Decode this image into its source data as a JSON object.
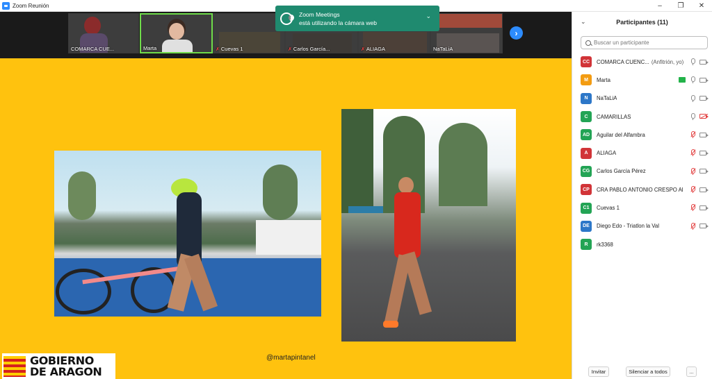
{
  "window": {
    "title": "Zoom Reunión"
  },
  "toast": {
    "line1": "Zoom Meetings",
    "line2": "está utilizando la cámara web"
  },
  "video_strip": [
    {
      "label": "COMARCA CUE...",
      "muted": false,
      "bg": "#cfc6bf"
    },
    {
      "label": "Marta",
      "muted": false,
      "bg": "#d8d4cf"
    },
    {
      "label": "Cuevas 1",
      "muted": true,
      "bg": "#6c6a64"
    },
    {
      "label": "Carlos García...",
      "muted": true,
      "bg": "#5c5a58"
    },
    {
      "label": "ALIAGA",
      "muted": true,
      "bg": "#6a5f57"
    },
    {
      "label": "NaTaLiA",
      "muted": false,
      "bg": "#7e7a78"
    }
  ],
  "shared": {
    "handle": "@martapintanel",
    "logo_line1": "GOBIERNO",
    "logo_line2": "DE ARAGON",
    "bg": "#ffc20e"
  },
  "panel": {
    "title": "Participantes (11)",
    "search_placeholder": "Buscar un participante",
    "participants": [
      {
        "initials": "CC",
        "name": "COMARCA CUENC...",
        "role": "(Anfitrión, yo)",
        "color": "#d13438",
        "mic": "on",
        "cam": "on",
        "sharing": false
      },
      {
        "initials": "M",
        "name": "Marta",
        "role": "",
        "color": "#f39c12",
        "mic": "on",
        "cam": "on",
        "sharing": true
      },
      {
        "initials": "N",
        "name": "NaTaLiA",
        "role": "",
        "color": "#2d77c8",
        "mic": "on",
        "cam": "on",
        "sharing": false
      },
      {
        "initials": "C",
        "name": "CAMARILLAS",
        "role": "",
        "color": "#23a455",
        "mic": "on",
        "cam": "off",
        "sharing": false
      },
      {
        "initials": "AD",
        "name": "Aguilar del Alfambra",
        "role": "",
        "color": "#23a455",
        "mic": "muted",
        "cam": "on",
        "sharing": false
      },
      {
        "initials": "A",
        "name": "ALIAGA",
        "role": "",
        "color": "#d13438",
        "mic": "muted",
        "cam": "on",
        "sharing": false
      },
      {
        "initials": "CG",
        "name": "Carlos García Pérez",
        "role": "",
        "color": "#23a455",
        "mic": "muted",
        "cam": "on",
        "sharing": false
      },
      {
        "initials": "CP",
        "name": "CRA PABLO ANTONIO CRESPO Al...",
        "role": "",
        "color": "#d13438",
        "mic": "muted",
        "cam": "on",
        "sharing": false
      },
      {
        "initials": "C1",
        "name": "Cuevas 1",
        "role": "",
        "color": "#23a455",
        "mic": "muted",
        "cam": "on",
        "sharing": false
      },
      {
        "initials": "DE",
        "name": "Diego Edo - Triatlon la Val",
        "role": "",
        "color": "#2d77c8",
        "mic": "muted",
        "cam": "on",
        "sharing": false
      },
      {
        "initials": "R",
        "name": "rk3368",
        "role": "",
        "color": "#23a455",
        "mic": "none",
        "cam": "none",
        "sharing": false
      }
    ],
    "invite_label": "Invitar",
    "mute_all_label": "Silenciar a todos",
    "more_label": "..."
  }
}
